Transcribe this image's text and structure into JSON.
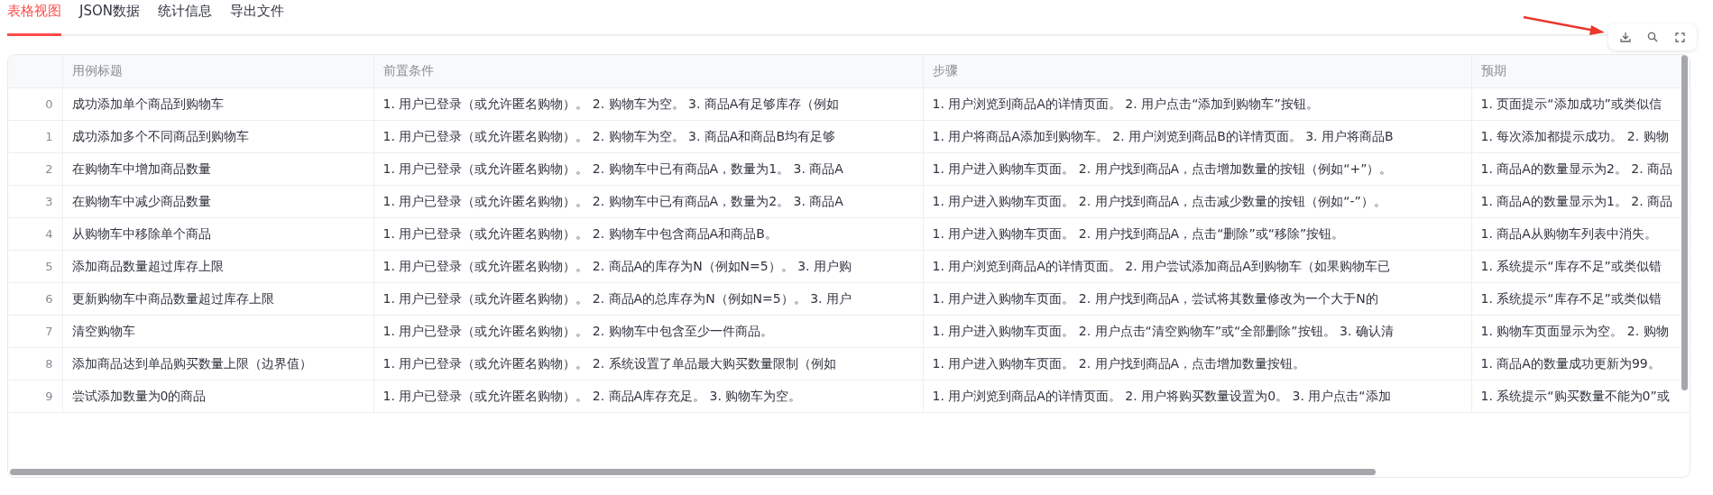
{
  "tabs": [
    {
      "label": "表格视图",
      "selected": true
    },
    {
      "label": "JSON数据",
      "selected": false
    },
    {
      "label": "统计信息",
      "selected": false
    },
    {
      "label": "导出文件",
      "selected": false
    }
  ],
  "table": {
    "columns": [
      "用例标题",
      "前置条件",
      "步骤",
      "预期"
    ],
    "rows": [
      {
        "index": "0",
        "cells": [
          "成功添加单个商品到购物车",
          "1. 用户已登录（或允许匿名购物）。 2. 购物车为空。 3. 商品A有足够库存（例如",
          "1. 用户浏览到商品A的详情页面。 2. 用户点击“添加到购物车”按钮。",
          "1. 页面提示“添加成功”或类似信"
        ]
      },
      {
        "index": "1",
        "cells": [
          "成功添加多个不同商品到购物车",
          "1. 用户已登录（或允许匿名购物）。 2. 购物车为空。 3. 商品A和商品B均有足够",
          "1. 用户将商品A添加到购物车。 2. 用户浏览到商品B的详情页面。 3. 用户将商品B",
          "1. 每次添加都提示成功。 2. 购物"
        ]
      },
      {
        "index": "2",
        "cells": [
          "在购物车中增加商品数量",
          "1. 用户已登录（或允许匿名购物）。 2. 购物车中已有商品A，数量为1。 3. 商品A",
          "1. 用户进入购物车页面。 2. 用户找到商品A，点击增加数量的按钮（例如“+”）。",
          "1. 商品A的数量显示为2。 2. 商品"
        ]
      },
      {
        "index": "3",
        "cells": [
          "在购物车中减少商品数量",
          "1. 用户已登录（或允许匿名购物）。 2. 购物车中已有商品A，数量为2。 3. 商品A",
          "1. 用户进入购物车页面。 2. 用户找到商品A，点击减少数量的按钮（例如“-”）。",
          "1. 商品A的数量显示为1。 2. 商品"
        ]
      },
      {
        "index": "4",
        "cells": [
          "从购物车中移除单个商品",
          "1. 用户已登录（或允许匿名购物）。 2. 购物车中包含商品A和商品B。",
          "1. 用户进入购物车页面。 2. 用户找到商品A，点击“删除”或“移除”按钮。",
          "1. 商品A从购物车列表中消失。"
        ]
      },
      {
        "index": "5",
        "cells": [
          "添加商品数量超过库存上限",
          "1. 用户已登录（或允许匿名购物）。 2. 商品A的库存为N（例如N=5）。 3. 用户购",
          "1. 用户浏览到商品A的详情页面。 2. 用户尝试添加商品A到购物车（如果购物车已",
          "1. 系统提示“库存不足”或类似错"
        ]
      },
      {
        "index": "6",
        "cells": [
          "更新购物车中商品数量超过库存上限",
          "1. 用户已登录（或允许匿名购物）。 2. 商品A的总库存为N（例如N=5）。 3. 用户",
          "1. 用户进入购物车页面。 2. 用户找到商品A，尝试将其数量修改为一个大于N的",
          "1. 系统提示“库存不足”或类似错"
        ]
      },
      {
        "index": "7",
        "cells": [
          "清空购物车",
          "1. 用户已登录（或允许匿名购物）。 2. 购物车中包含至少一件商品。",
          "1. 用户进入购物车页面。 2. 用户点击“清空购物车”或“全部删除”按钮。 3. 确认清",
          "1. 购物车页面显示为空。 2. 购物"
        ]
      },
      {
        "index": "8",
        "cells": [
          "添加商品达到单品购买数量上限（边界值）",
          "1. 用户已登录（或允许匿名购物）。 2. 系统设置了单品最大购买数量限制（例如",
          "1. 用户进入购物车页面。 2. 用户找到商品A，点击增加数量按钮。",
          "1. 商品A的数量成功更新为99。"
        ]
      },
      {
        "index": "9",
        "cells": [
          "尝试添加数量为0的商品",
          "1. 用户已登录（或允许匿名购物）。 2. 商品A库存充足。 3. 购物车为空。",
          "1. 用户浏览到商品A的详情页面。 2. 用户将购买数量设置为0。 3. 用户点击“添加",
          "1. 系统提示“购买数量不能为0”或"
        ]
      }
    ]
  }
}
